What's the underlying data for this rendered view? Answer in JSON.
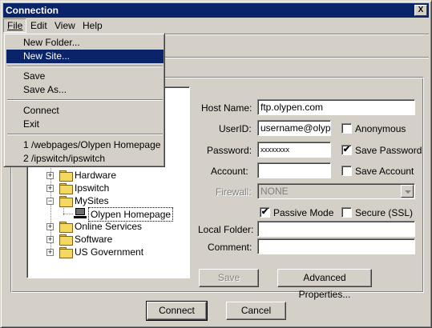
{
  "window": {
    "title": "Connection",
    "close_label": "X"
  },
  "menubar": {
    "items": [
      "File",
      "Edit",
      "View",
      "Help"
    ]
  },
  "file_menu": {
    "items": [
      "New Folder...",
      "New Site...",
      "Save",
      "Save As...",
      "Connect",
      "Exit",
      "1 /webpages/Olypen Homepage",
      "2 /ipswitch/ipswitch"
    ],
    "highlighted": "New Site..."
  },
  "tree": {
    "items": [
      {
        "label": "Hardware",
        "type": "folder"
      },
      {
        "label": "Ipswitch",
        "type": "folder"
      },
      {
        "label": "MySites",
        "type": "folder",
        "expanded": true
      },
      {
        "label": "Olypen Homepage",
        "type": "site",
        "selected": true
      },
      {
        "label": "Online Services",
        "type": "folder"
      },
      {
        "label": "Software",
        "type": "folder"
      },
      {
        "label": "US Government",
        "type": "folder"
      }
    ]
  },
  "form": {
    "host_name_label": "Host Name:",
    "host_name_value": "ftp.olypen.com",
    "userid_label": "UserID:",
    "userid_value": "username@olypen.com",
    "password_label": "Password:",
    "password_value": "xxxxxxxx",
    "account_label": "Account:",
    "account_value": "",
    "firewall_label": "Firewall:",
    "firewall_value": "NONE",
    "local_folder_label": "Local Folder:",
    "local_folder_value": "",
    "comment_label": "Comment:",
    "comment_value": "",
    "anonymous_label": "Anonymous",
    "anonymous_checked": false,
    "save_password_label": "Save Password",
    "save_password_checked": true,
    "save_account_label": "Save Account",
    "save_account_checked": false,
    "passive_mode_label": "Passive Mode",
    "passive_mode_checked": true,
    "secure_ssl_label": "Secure (SSL)",
    "secure_ssl_checked": false,
    "check_mark": "✔"
  },
  "buttons": {
    "save": "Save",
    "advanced": "Advanced Properties...",
    "connect": "Connect",
    "cancel": "Cancel"
  },
  "colors": {
    "face": "#d4d0c8",
    "titlebar": "#0a246a",
    "highlight": "#0a246a"
  }
}
